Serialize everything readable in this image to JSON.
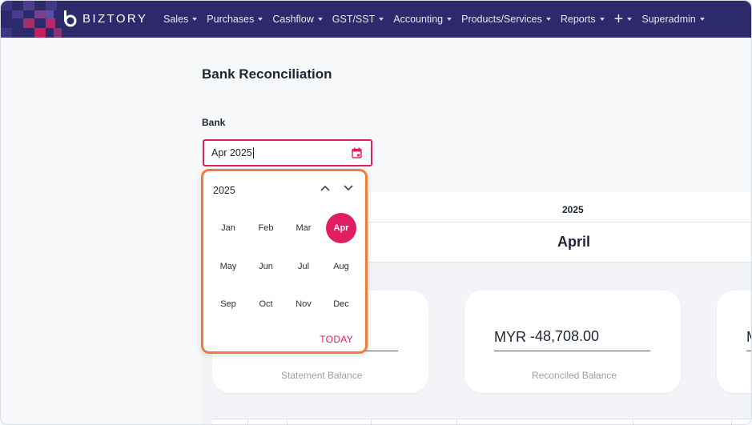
{
  "brand": {
    "name": "BIZTORY"
  },
  "nav": {
    "items": [
      {
        "label": "Sales"
      },
      {
        "label": "Purchases"
      },
      {
        "label": "Cashflow"
      },
      {
        "label": "GST/SST"
      },
      {
        "label": "Accounting"
      },
      {
        "label": "Products/Services"
      },
      {
        "label": "Reports"
      },
      {
        "label": "+"
      },
      {
        "label": "Superadmin"
      }
    ]
  },
  "page": {
    "title": "Bank Reconciliation"
  },
  "bank": {
    "label": "Bank",
    "input_value": "Apr 2025",
    "icon": "calendar-icon"
  },
  "summary": {
    "year": "2025",
    "month": "April",
    "cards": [
      {
        "label": "Statement Balance",
        "currency": "",
        "value": ""
      },
      {
        "label": "Reconciled Balance",
        "currency": "MYR",
        "value": "-48,708.00"
      },
      {
        "label": "",
        "currency": "M",
        "value": ""
      }
    ]
  },
  "datepicker": {
    "year": "2025",
    "months": [
      "Jan",
      "Feb",
      "Mar",
      "Apr",
      "May",
      "Jun",
      "Jul",
      "Aug",
      "Sep",
      "Oct",
      "Nov",
      "Dec"
    ],
    "selected": "Apr",
    "today_label": "TODAY",
    "prev_icon": "chevron-up-icon",
    "next_icon": "chevron-down-icon"
  },
  "colors": {
    "navbar": "#2d2a6b",
    "accent": "#e01f63",
    "picker_highlight": "#f27a3c"
  }
}
